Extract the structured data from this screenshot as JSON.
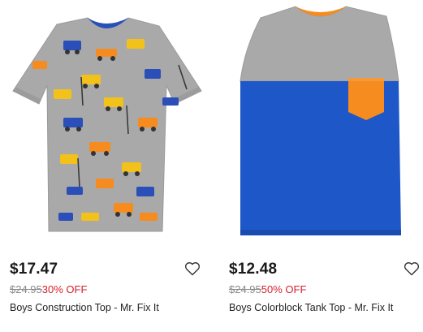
{
  "products": [
    {
      "price": "$17.47",
      "original_price": "$24.95",
      "discount": "30% OFF",
      "name": "Boys Construction Top - Mr. Fix It",
      "icon": "heart-outline-icon"
    },
    {
      "price": "$12.48",
      "original_price": "$24.95",
      "discount": "50% OFF",
      "name": "Boys Colorblock Tank Top - Mr. Fix It",
      "icon": "heart-outline-icon"
    }
  ],
  "colors": {
    "discount": "#d6202c",
    "strike_price": "#8a8a8a",
    "shirt_gray": "#a9a9a9",
    "tank_blue": "#1e57c8",
    "pocket_orange": "#f68b1f"
  }
}
